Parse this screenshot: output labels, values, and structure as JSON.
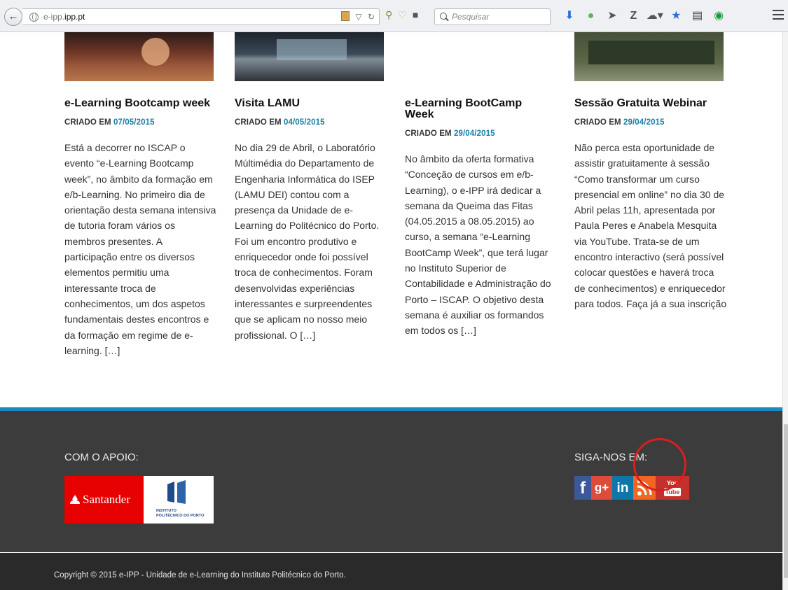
{
  "browser": {
    "url_prefix": "e-ipp.",
    "url_domain": "ipp.pt",
    "search_placeholder": "Pesquisar"
  },
  "articles": [
    {
      "title": "e-Learning Bootcamp week",
      "created_label": "CRIADO EM",
      "date": "07/05/2015",
      "excerpt": "Está a decorrer no ISCAP o evento “e-Learning Bootcamp week”, no âmbito da formação em e/b-Learning. No primeiro dia de orientação desta semana intensiva de tutoria foram vários os membros presentes. A participação entre os diversos elementos permitiu uma interessante troca de conhecimentos, um dos aspetos fundamentais destes encontros e da formação em regime de e-learning. […]"
    },
    {
      "title": "Visita LAMU",
      "created_label": "CRIADO EM",
      "date": "04/05/2015",
      "excerpt": "No dia 29 de Abril, o Laboratório Múltimédia do Departamento de Engenharia Informática do ISEP (LAMU DEI) contou com a presença da Unidade de e-Learning do Politécnico do Porto. Foi um encontro produtivo e enriquecedor onde foi possível troca de conhecimentos. Foram desenvolvidas experiências interessantes e surpreendentes que se aplicam no nosso meio profissional. O […]"
    },
    {
      "title": "e-Learning BootCamp Week",
      "created_label": "CRIADO EM",
      "date": "29/04/2015",
      "excerpt": " No âmbito da oferta formativa “Conceção de cursos em e/b-Learning), o e-IPP irá dedicar a semana da Queima das Fitas (04.05.2015 a 08.05.2015) ao curso, a semana “e-Learning BootCamp Week”, que terá lugar no Instituto Superior de Contabilidade e Administração do Porto – ISCAP. O objetivo desta semana é auxiliar os formandos em todos os […]"
    },
    {
      "title": "Sessão Gratuita Webinar",
      "created_label": "CRIADO EM",
      "date": "29/04/2015",
      "excerpt": "Não perca esta oportunidade de assistir gratuitamente à sessão “Como transformar um curso presencial em online” no dia 30 de Abril pelas 11h, apresentada por Paula Peres e Anabela Mesquita via YouTube. Trata-se de um encontro interactivo (será possível colocar questões e haverá troca de conhecimentos) e enriquecedor para todos. Faça já a sua inscrição"
    }
  ],
  "footer": {
    "support_label": "COM O APOIO:",
    "santander": "Santander",
    "ipp_line1": "INSTITUTO",
    "ipp_line2": "POLITÉCNICO DO PORTO",
    "follow_label": "SIGA-NOS EM:",
    "social": {
      "facebook": "f",
      "googleplus": "g+",
      "linkedin": "in",
      "youtube_top": "You",
      "youtube_bottom": "Tube"
    },
    "copyright": "Copyright © 2015 e-IPP - Unidade de e-Learning do Instituto Politécnico do Porto."
  },
  "colors": {
    "accent": "#1a8ac1",
    "footer_bg": "#3c3c3c",
    "highlight": "#d91e1e"
  }
}
